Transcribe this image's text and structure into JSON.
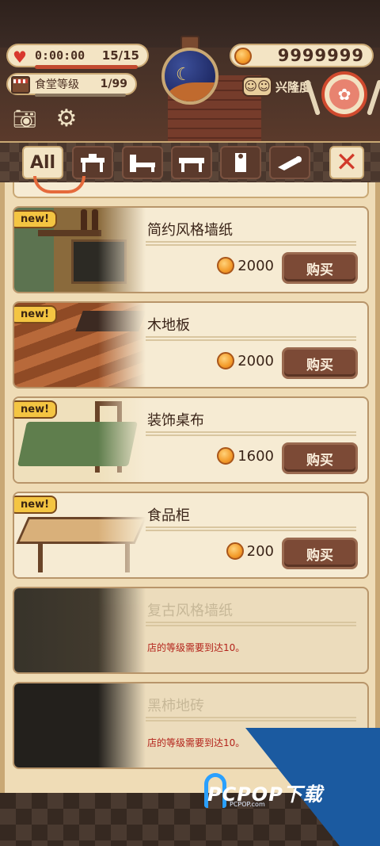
{
  "hud": {
    "time": "0:00:00",
    "hearts": "15/15",
    "level_label": "食堂等级",
    "level": "1/99",
    "coins": "9999999",
    "popularity_label": "兴隆度"
  },
  "tabs": [
    {
      "label": "All",
      "icon": "all"
    },
    {
      "label": "",
      "icon": "table-chairs-icon"
    },
    {
      "label": "",
      "icon": "seating-icon"
    },
    {
      "label": "",
      "icon": "table-icon"
    },
    {
      "label": "",
      "icon": "wallpaper-icon"
    },
    {
      "label": "",
      "icon": "floor-roll-icon"
    }
  ],
  "items": [
    {
      "name": "简约风格墙纸",
      "price": "2000",
      "buy": "购买",
      "new": "new!",
      "locked": false
    },
    {
      "name": "木地板",
      "price": "2000",
      "buy": "购买",
      "new": "new!",
      "locked": false
    },
    {
      "name": "装饰桌布",
      "price": "1600",
      "buy": "购买",
      "new": "new!",
      "locked": false
    },
    {
      "name": "食品柜",
      "price": "200",
      "buy": "购买",
      "new": "new!",
      "locked": false
    },
    {
      "name": "复古风格墙纸",
      "requirement": "店的等级需要到达10。",
      "locked": true
    },
    {
      "name": "黑柿地砖",
      "requirement": "店的等级需要到达10。",
      "locked": true
    }
  ],
  "watermark": {
    "text": "PCPOP下载",
    "sub": "PCPOP.com"
  },
  "colors": {
    "accent": "#7c4a36",
    "badge": "#f4c542",
    "warning": "#b3221a",
    "panel": "#efdcb6"
  }
}
